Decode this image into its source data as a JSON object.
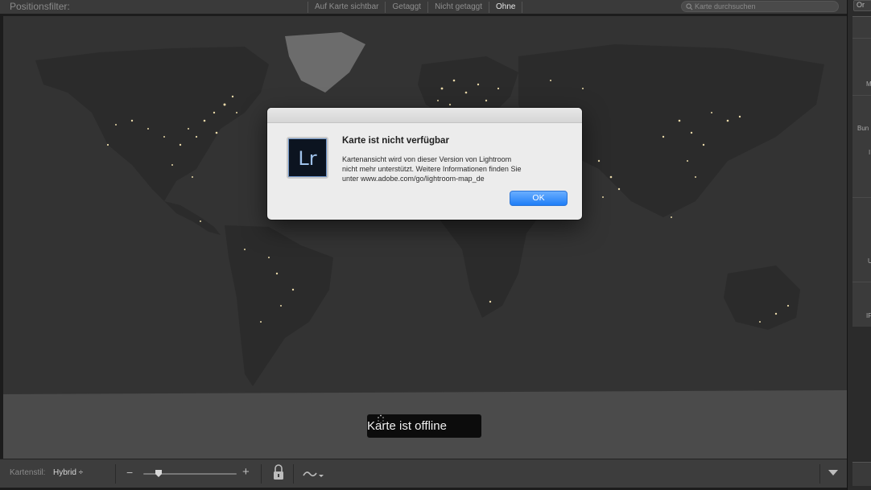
{
  "header": {
    "title": "Positionsfilter:",
    "filters": [
      {
        "label": "Auf Karte sichtbar",
        "active": false
      },
      {
        "label": "Getaggt",
        "active": false
      },
      {
        "label": "Nicht getaggt",
        "active": false
      },
      {
        "label": "Ohne",
        "active": true
      }
    ],
    "search_placeholder": "Karte durchsuchen"
  },
  "map": {
    "status_text": "Karte ist offline",
    "colors": {
      "ocean": "#333333",
      "land": "#2a2a2a",
      "lights": "#e8d8a8"
    }
  },
  "dialog": {
    "title": "Karte ist nicht verfügbar",
    "message_lines": [
      "Kartenansicht wird von dieser Version von Lightroom",
      "nicht mehr unterstützt.  Weitere Informationen finden Sie",
      "unter www.adobe.com/go/lightroom-map_de"
    ],
    "icon_text": "Lr",
    "ok_label": "OK",
    "accent": "#1f7ef7"
  },
  "toolbar": {
    "style_label": "Kartenstil:",
    "style_value": "Hybrid ÷",
    "zoom_minus": "−",
    "zoom_plus": "+",
    "zoom_level": 0.15
  },
  "right_panel": {
    "top_label": "Or",
    "fragments": [
      "M",
      "Bun",
      "I",
      "U",
      "IF"
    ]
  }
}
